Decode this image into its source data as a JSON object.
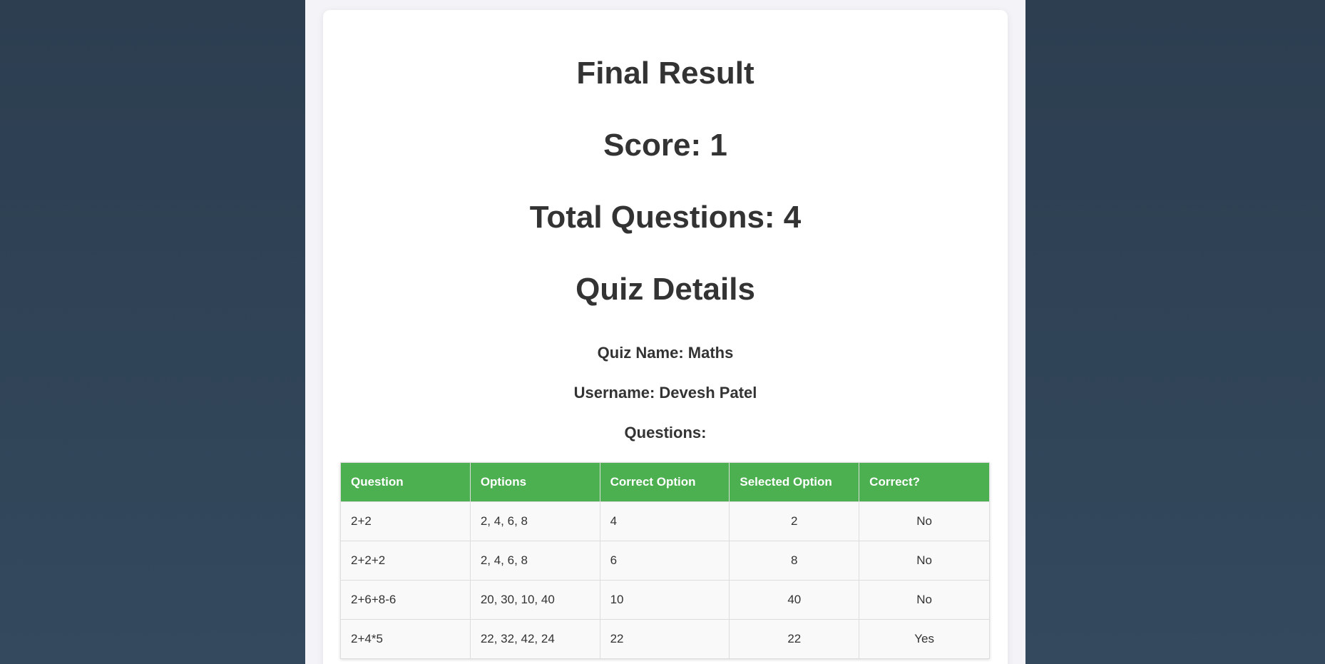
{
  "result": {
    "title": "Final Result",
    "score_text": "Score: 1",
    "total_text": "Total Questions: 4"
  },
  "details": {
    "title": "Quiz Details",
    "quiz_name_text": "Quiz Name: Maths",
    "username_text": "Username: Devesh Patel",
    "questions_label": "Questions:"
  },
  "table": {
    "headers": [
      "Question",
      "Options",
      "Correct Option",
      "Selected Option",
      "Correct?"
    ],
    "rows": [
      {
        "question": "2+2",
        "options": "2, 4, 6, 8",
        "correct": "4",
        "selected": "2",
        "is_correct": "No"
      },
      {
        "question": "2+2+2",
        "options": "2, 4, 6, 8",
        "correct": "6",
        "selected": "8",
        "is_correct": "No"
      },
      {
        "question": "2+6+8-6",
        "options": "20, 30, 10, 40",
        "correct": "10",
        "selected": "40",
        "is_correct": "No"
      },
      {
        "question": "2+4*5",
        "options": "22, 32, 42, 24",
        "correct": "22",
        "selected": "22",
        "is_correct": "Yes"
      }
    ]
  },
  "colors": {
    "header_green": "#4caf50",
    "background_dark": "#2c3e50",
    "text": "#333333"
  }
}
